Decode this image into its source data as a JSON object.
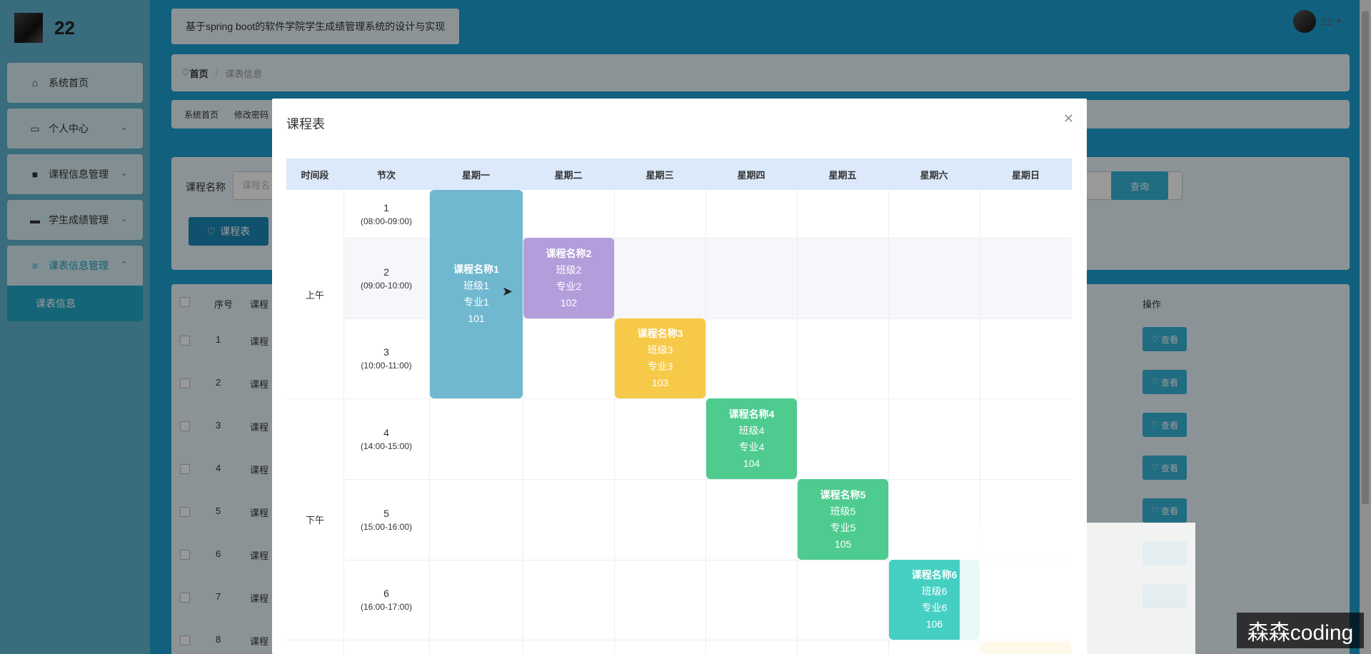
{
  "sidebar": {
    "username": "22",
    "menu": [
      {
        "label": "系统首页",
        "icon": "home-icon",
        "chev": ""
      },
      {
        "label": "个人中心",
        "icon": "card-icon",
        "chev": "⌄"
      },
      {
        "label": "课程信息管理",
        "icon": "grid-icon",
        "chev": "⌄"
      },
      {
        "label": "学生成绩管理",
        "icon": "monitor-icon",
        "chev": "⌄"
      },
      {
        "label": "课表信息管理",
        "icon": "list-icon",
        "chev": "⌃"
      }
    ],
    "submenu_label": "课表信息"
  },
  "header": {
    "title": "基于spring boot的软件学院学生成绩管理系统的设计与实现",
    "user": "22"
  },
  "breadcrumb": {
    "home": "首页",
    "current": "课表信息"
  },
  "tags": [
    "系统首页",
    "修改密码"
  ],
  "search": {
    "label": "课程名称",
    "placeholder": "课程名",
    "query_button": "查询",
    "schedule_button": "课程表"
  },
  "table": {
    "headers": {
      "index": "序号",
      "name": "课程",
      "action": "操作"
    },
    "rows": [
      {
        "index": "1",
        "name": "课程",
        "action": "查看"
      },
      {
        "index": "2",
        "name": "课程",
        "action": "查看"
      },
      {
        "index": "3",
        "name": "课程",
        "action": "查看"
      },
      {
        "index": "4",
        "name": "课程",
        "action": "查看"
      },
      {
        "index": "5",
        "name": "课程",
        "action": "查看"
      },
      {
        "index": "6",
        "name": "课程",
        "action": ""
      },
      {
        "index": "7",
        "name": "课程",
        "action": ""
      },
      {
        "index": "8",
        "name": "课程",
        "action": ""
      }
    ]
  },
  "dialog": {
    "title": "课程表",
    "headers": [
      "时间段",
      "节次",
      "星期一",
      "星期二",
      "星期三",
      "星期四",
      "星期五",
      "星期六",
      "星期日"
    ],
    "periods": [
      "上午",
      "下午"
    ],
    "slots": [
      {
        "num": "1",
        "time": "(08:00-09:00)"
      },
      {
        "num": "2",
        "time": "(09:00-10:00)"
      },
      {
        "num": "3",
        "time": "(10:00-11:00)"
      },
      {
        "num": "4",
        "time": "(14:00-15:00)"
      },
      {
        "num": "5",
        "time": "(15:00-16:00)"
      },
      {
        "num": "6",
        "time": "(16:00-17:00)"
      }
    ],
    "courses": [
      {
        "name": "课程名称1",
        "class": "班级1",
        "major": "专业1",
        "room": "101",
        "color": "#6fb8cf"
      },
      {
        "name": "课程名称2",
        "class": "班级2",
        "major": "专业2",
        "room": "102",
        "color": "#b39ddb"
      },
      {
        "name": "课程名称3",
        "class": "班级3",
        "major": "专业3",
        "room": "103",
        "color": "#f7c948"
      },
      {
        "name": "课程名称4",
        "class": "班级4",
        "major": "专业4",
        "room": "104",
        "color": "#4ecb8f"
      },
      {
        "name": "课程名称5",
        "class": "班级5",
        "major": "专业5",
        "room": "105",
        "color": "#4ecb8f"
      },
      {
        "name": "课程名称6",
        "class": "班级6",
        "major": "专业6",
        "room": "106",
        "color": "#45cfc3"
      }
    ]
  },
  "watermark": "森森coding"
}
